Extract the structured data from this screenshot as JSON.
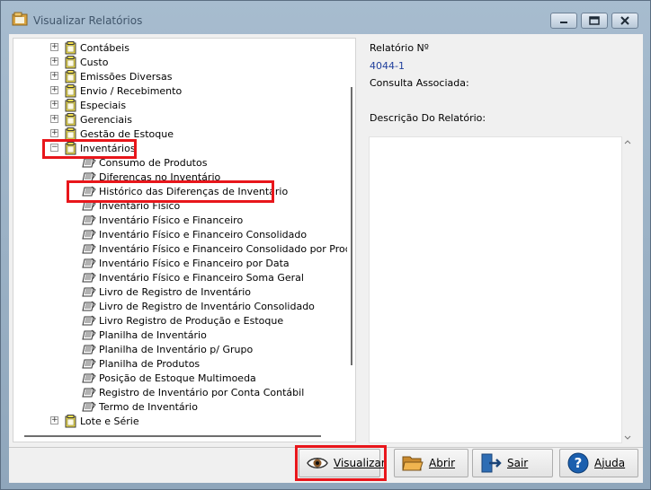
{
  "window": {
    "title": "Visualizar Relatórios"
  },
  "tree": {
    "items": [
      {
        "label": "Contábeis",
        "type": "folder",
        "expander": "+"
      },
      {
        "label": "Custo",
        "type": "folder",
        "expander": "+"
      },
      {
        "label": "Emissões Diversas",
        "type": "folder",
        "expander": "+"
      },
      {
        "label": "Envio / Recebimento",
        "type": "folder",
        "expander": "+"
      },
      {
        "label": "Especiais",
        "type": "folder",
        "expander": "+"
      },
      {
        "label": "Gerenciais",
        "type": "folder",
        "expander": "+"
      },
      {
        "label": "Gestão de Estoque",
        "type": "folder",
        "expander": "+"
      },
      {
        "label": "Inventários",
        "type": "folder",
        "expander": "−"
      },
      {
        "label": "Consumo de Produtos",
        "type": "report"
      },
      {
        "label": "Diferencas no Inventário",
        "type": "report"
      },
      {
        "label": "Histórico das Diferenças de Inventário",
        "type": "report"
      },
      {
        "label": "Inventário Físico",
        "type": "report"
      },
      {
        "label": "Inventário Físico e Financeiro",
        "type": "report"
      },
      {
        "label": "Inventário Físico e Financeiro Consolidado",
        "type": "report"
      },
      {
        "label": "Inventário Físico e Financeiro Consolidado por Produ",
        "type": "report"
      },
      {
        "label": "Inventário Físico e Financeiro por Data",
        "type": "report"
      },
      {
        "label": "Inventário Físico e Financeiro Soma Geral",
        "type": "report"
      },
      {
        "label": "Livro de Registro de Inventário",
        "type": "report"
      },
      {
        "label": "Livro de Registro de Inventário Consolidado",
        "type": "report"
      },
      {
        "label": "Livro Registro de Produção e Estoque",
        "type": "report"
      },
      {
        "label": "Planilha de Inventário",
        "type": "report"
      },
      {
        "label": "Planilha de Inventário p/ Grupo",
        "type": "report"
      },
      {
        "label": "Planilha de Produtos",
        "type": "report"
      },
      {
        "label": "Posição de Estoque Multimoeda",
        "type": "report"
      },
      {
        "label": "Registro de Inventário por Conta Contábil",
        "type": "report"
      },
      {
        "label": "Termo de Inventário",
        "type": "report"
      },
      {
        "label": "Lote e Série",
        "type": "folder",
        "expander": "+"
      }
    ]
  },
  "details": {
    "report_number_label": "Relatório Nº",
    "report_number_value": "4044-1",
    "associated_query_label": "Consulta Associada:",
    "description_label": "Descrição Do Relatório:"
  },
  "buttons": {
    "view": "Visualizar",
    "open": "Abrir",
    "exit": "Sair",
    "help": "Ajuda"
  },
  "colors": {
    "highlight": "#e8161b",
    "value_text": "#1f3f9c"
  }
}
